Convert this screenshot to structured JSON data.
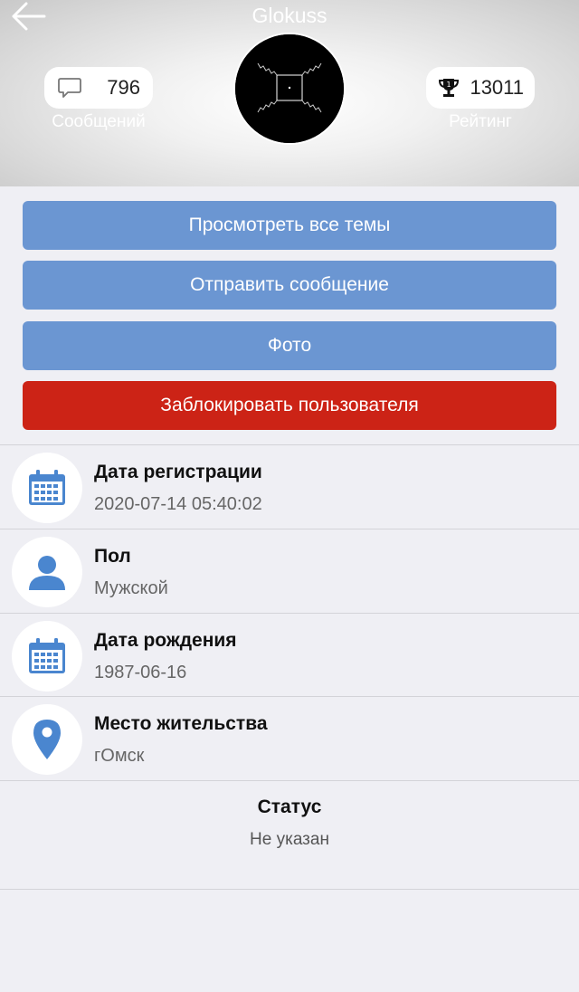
{
  "header": {
    "title": "Glokuss",
    "messages_count": "796",
    "messages_label": "Сообщений",
    "rating_value": "13011",
    "rating_label": "Рейтинг",
    "back_icon": "arrow-left-icon",
    "message_icon": "chat-bubble-icon",
    "trophy_icon": "trophy-icon"
  },
  "actions": {
    "view_topics": "Просмотреть все темы",
    "send_message": "Отправить сообщение",
    "photo": "Фото",
    "block_user": "Заблокировать пользователя"
  },
  "info": [
    {
      "title": "Дата регистрации",
      "value": "2020-07-14 05:40:02",
      "icon": "calendar-icon"
    },
    {
      "title": "Пол",
      "value": "Мужской",
      "icon": "user-icon"
    },
    {
      "title": "Дата рождения",
      "value": "1987-06-16",
      "icon": "calendar-icon"
    },
    {
      "title": "Место жительства",
      "value": "гОмск",
      "icon": "map-pin-icon"
    }
  ],
  "status": {
    "title": "Статус",
    "value": "Не указан"
  },
  "colors": {
    "accent_blue": "#6b96d2",
    "danger_red": "#cc2316",
    "icon_blue": "#4a86cf",
    "background": "#efeff4"
  }
}
